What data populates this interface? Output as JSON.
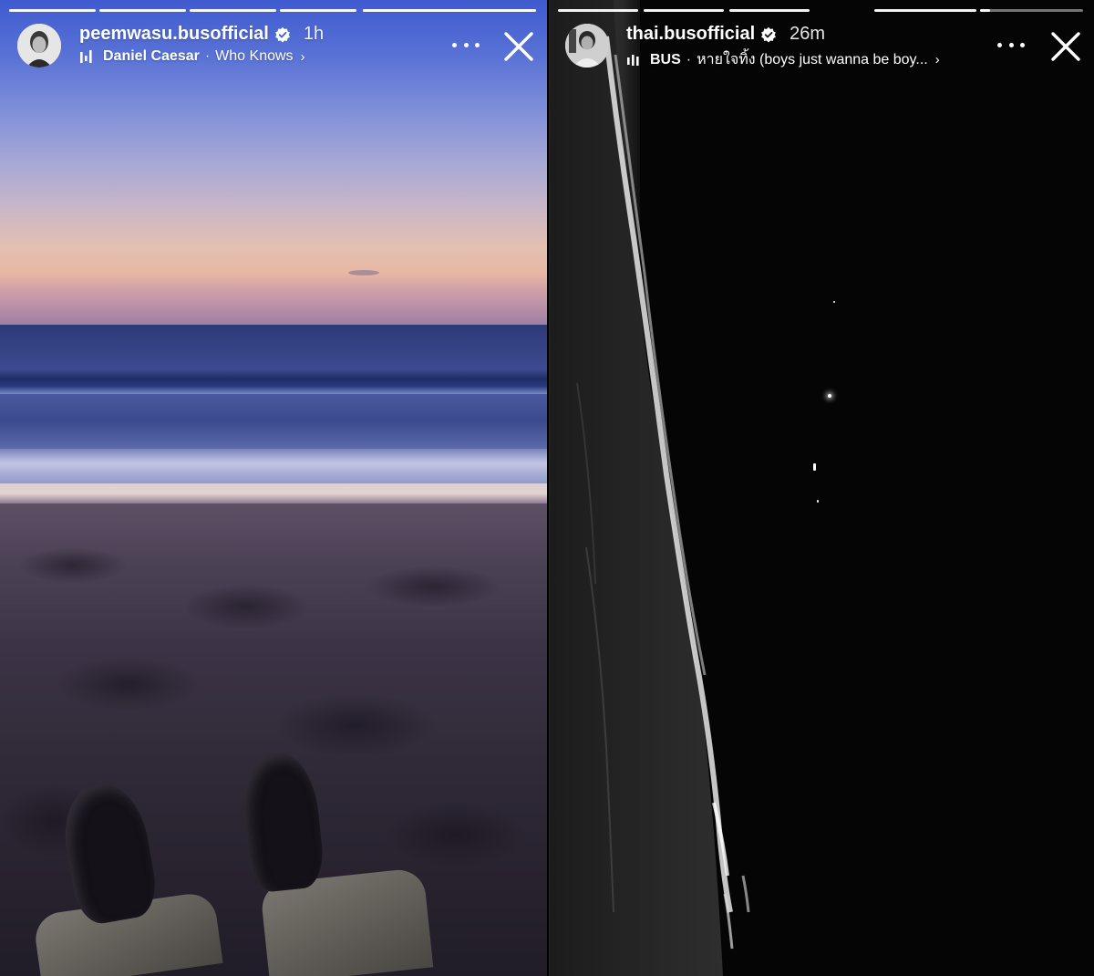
{
  "stories": [
    {
      "username": "peemwasu.busofficial",
      "time": "1h",
      "music_artist": "Daniel Caesar",
      "music_separator": "·",
      "music_title": "Who Knows",
      "progress_segments": 5,
      "active_segment_progress": 1.0
    },
    {
      "username": "thai.busofficial",
      "time": "26m",
      "music_artist": "BUS",
      "music_separator": "·",
      "music_title": "หายใจทิ้ง (boys just wanna be boy...",
      "progress_segments": 5,
      "active_segment_progress": 0.1
    }
  ],
  "icons": {
    "verified": "verified-badge-icon",
    "music": "music-equalizer-icon",
    "more": "more-options-icon",
    "close": "close-icon",
    "chevron": "chevron-right-icon"
  },
  "chevron_glyph": "›",
  "colors": {
    "text": "#ffffff",
    "verified_bg": "#ffffff",
    "progress_track": "rgba(255,255,255,0.45)"
  }
}
